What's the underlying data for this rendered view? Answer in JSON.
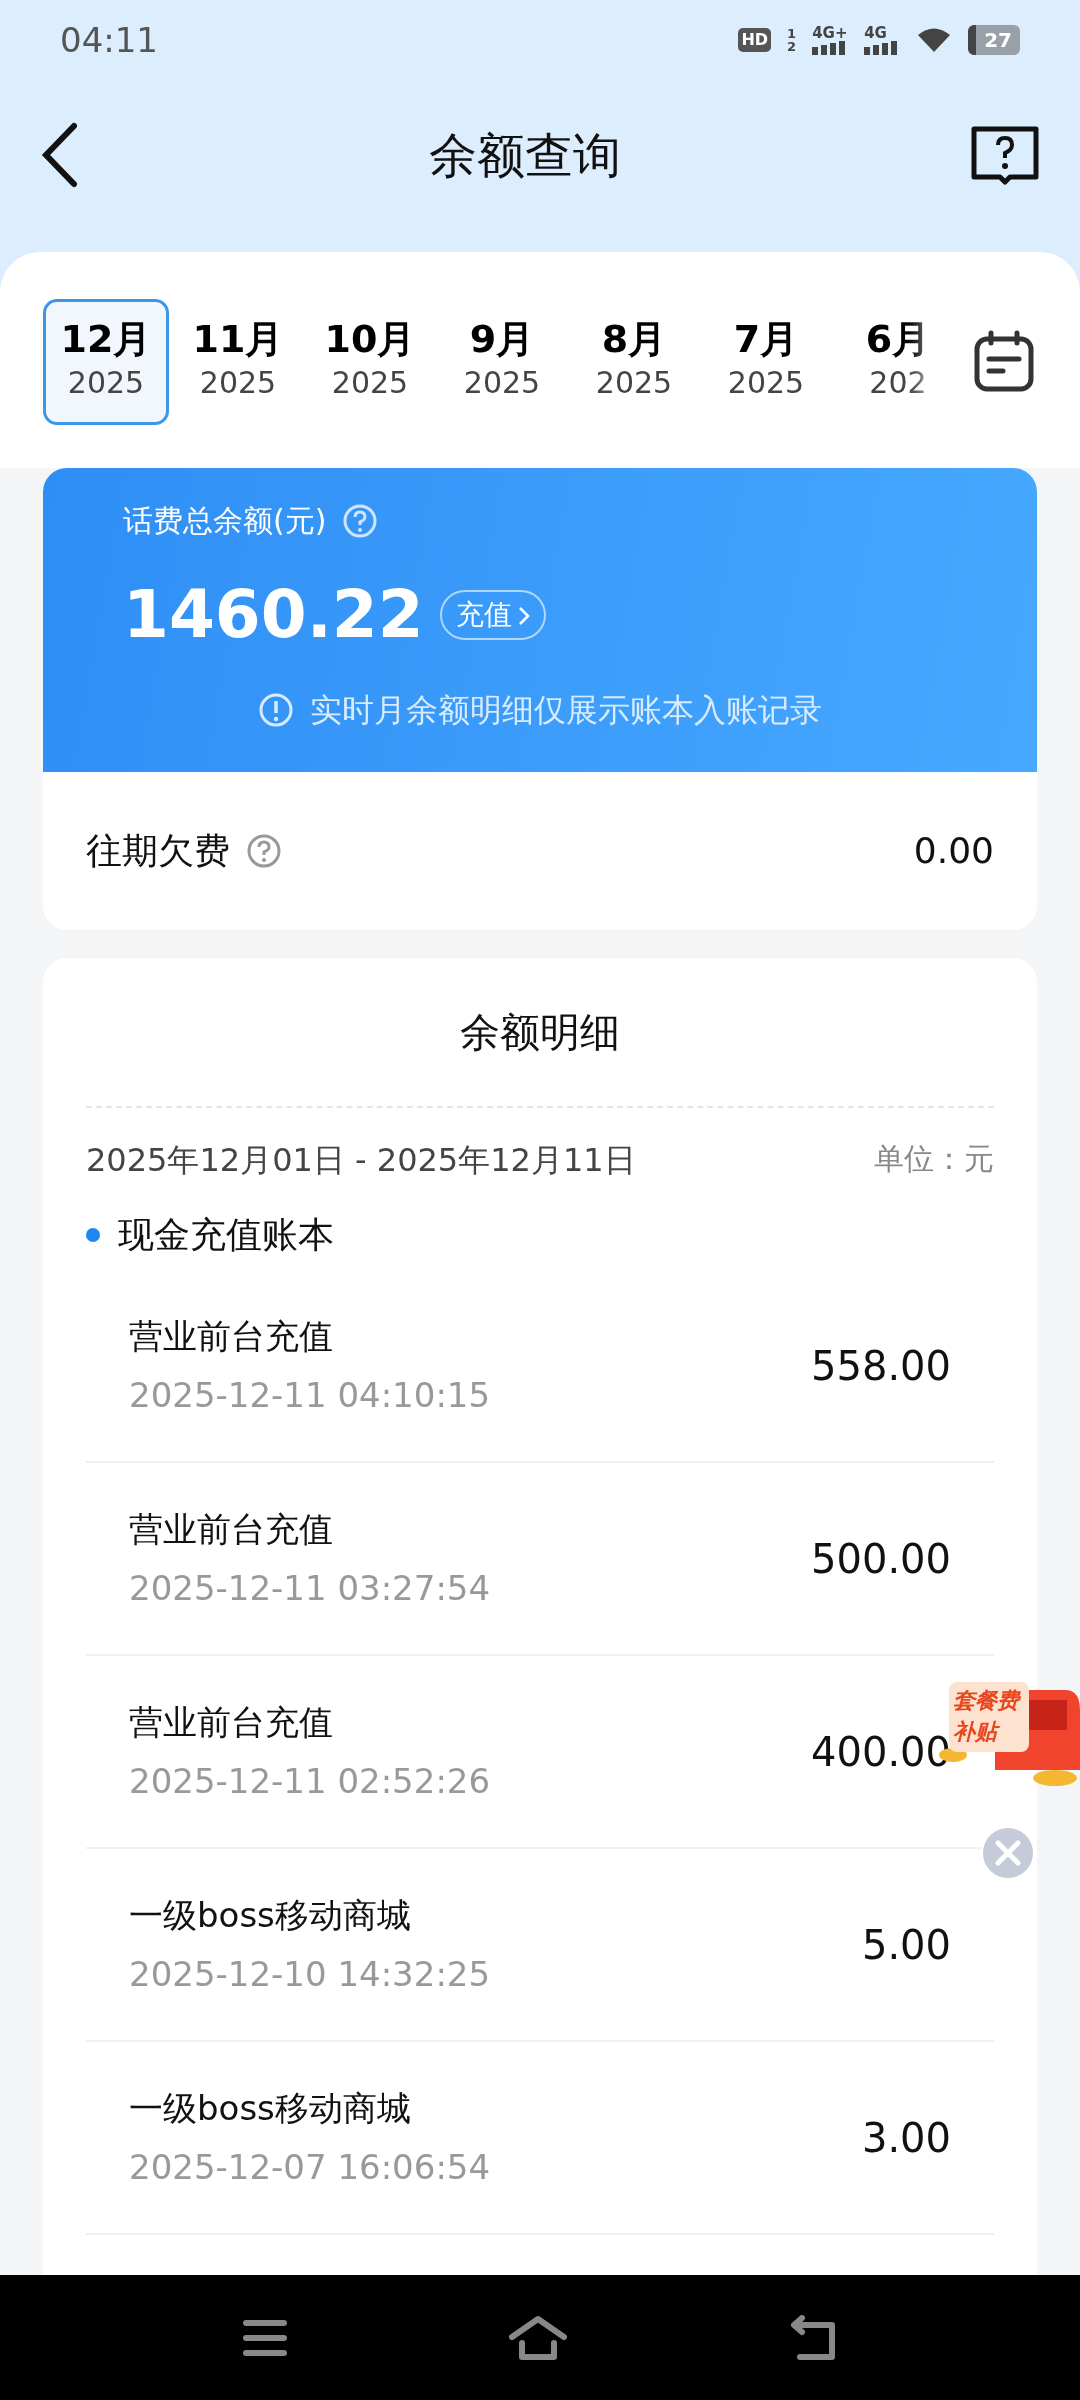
{
  "status_bar": {
    "time": "04:11",
    "hd": "HD",
    "sims": [
      "1",
      "2"
    ],
    "networks": [
      "4G+",
      "4G"
    ],
    "battery": "27"
  },
  "header": {
    "title": "余额查询"
  },
  "months": [
    {
      "month": "12月",
      "year": "2025",
      "selected": true
    },
    {
      "month": "11月",
      "year": "2025",
      "selected": false
    },
    {
      "month": "10月",
      "year": "2025",
      "selected": false
    },
    {
      "month": "9月",
      "year": "2025",
      "selected": false
    },
    {
      "month": "8月",
      "year": "2025",
      "selected": false
    },
    {
      "month": "7月",
      "year": "2025",
      "selected": false
    },
    {
      "month": "6月",
      "year": "202",
      "selected": false
    }
  ],
  "balance_card": {
    "label": "话费总余额(元)",
    "amount": "1460.22",
    "recharge": "充值",
    "notice": "实时月余额明细仅展示账本入账记录"
  },
  "arrears": {
    "label": "往期欠费",
    "amount": "0.00"
  },
  "details": {
    "title": "余额明细",
    "period": "2025年12月01日 - 2025年12月11日",
    "unit": "单位：元",
    "section": "现金充值账本",
    "rows": [
      {
        "name": "营业前台充值",
        "time": "2025-12-11 04:10:15",
        "amount": "558.00"
      },
      {
        "name": "营业前台充值",
        "time": "2025-12-11 03:27:54",
        "amount": "500.00"
      },
      {
        "name": "营业前台充值",
        "time": "2025-12-11 02:52:26",
        "amount": "400.00"
      },
      {
        "name": "一级boss移动商城",
        "time": "2025-12-10 14:32:25",
        "amount": "5.00"
      },
      {
        "name": "一级boss移动商城",
        "time": "2025-12-07 16:06:54",
        "amount": "3.00"
      }
    ]
  },
  "promo": {
    "text": "套餐费补贴"
  }
}
